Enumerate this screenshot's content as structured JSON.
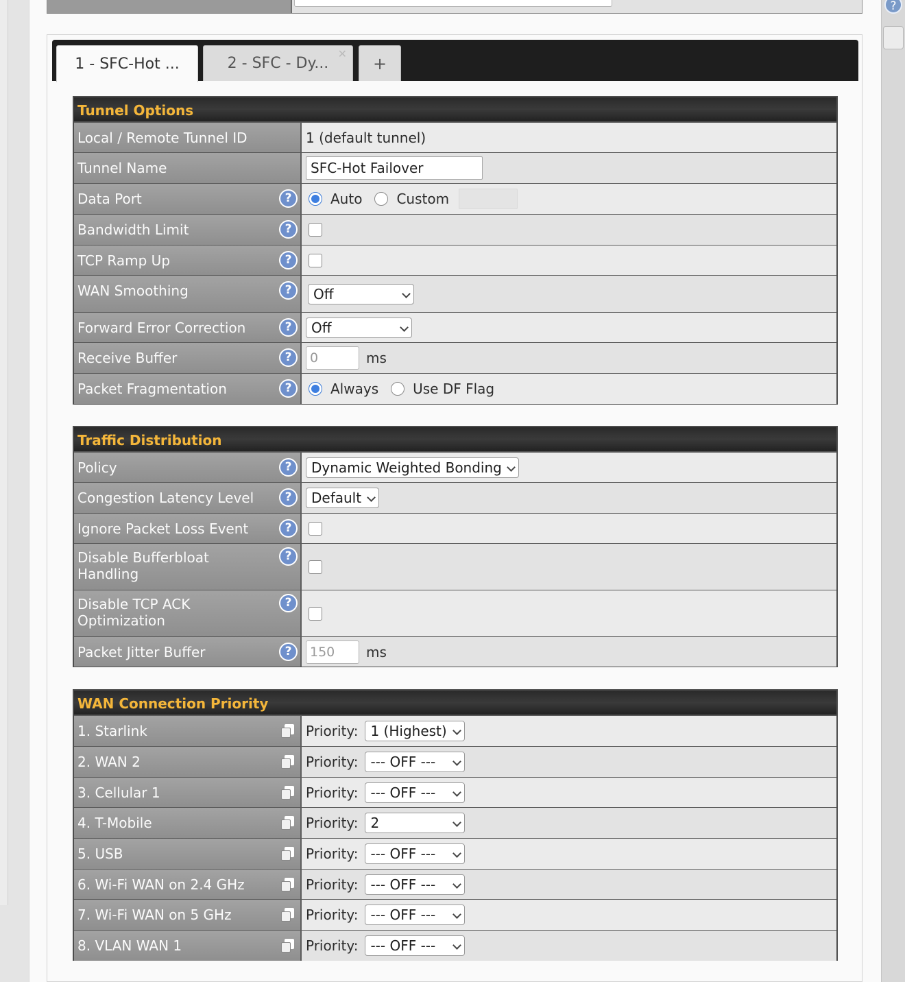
{
  "tabs": [
    {
      "label": "1 - SFC-Hot ..."
    },
    {
      "label": "2 - SFC - Dy..."
    },
    {
      "label": "+"
    }
  ],
  "tunnel_options": {
    "title": "Tunnel Options",
    "local_remote_label": "Local / Remote Tunnel ID",
    "local_remote_value": "1 (default tunnel)",
    "tunnel_name_label": "Tunnel Name",
    "tunnel_name_value": "SFC-Hot Failover",
    "data_port_label": "Data Port",
    "data_port_auto": "Auto",
    "data_port_custom": "Custom",
    "bandwidth_limit_label": "Bandwidth Limit",
    "tcp_ramp_up_label": "TCP Ramp Up",
    "wan_smoothing_label": "WAN Smoothing",
    "wan_smoothing_value": "Off",
    "fec_label": "Forward Error Correction",
    "fec_value": "Off",
    "receive_buffer_label": "Receive Buffer",
    "receive_buffer_value": "0",
    "receive_buffer_unit": "ms",
    "packet_frag_label": "Packet Fragmentation",
    "packet_frag_always": "Always",
    "packet_frag_df": "Use DF Flag"
  },
  "traffic_distribution": {
    "title": "Traffic Distribution",
    "policy_label": "Policy",
    "policy_value": "Dynamic Weighted Bonding",
    "congestion_label": "Congestion Latency Level",
    "congestion_value": "Default",
    "ignore_loss_label": "Ignore Packet Loss Event",
    "bufferbloat_label": "Disable Bufferbloat Handling",
    "tcp_ack_label": "Disable TCP ACK Optimization",
    "jitter_label": "Packet Jitter Buffer",
    "jitter_value": "150",
    "jitter_unit": "ms"
  },
  "wan_priority": {
    "title": "WAN Connection Priority",
    "priority_label": "Priority:",
    "rows": [
      {
        "name": "1. Starlink",
        "value": "1 (Highest)"
      },
      {
        "name": "2. WAN 2",
        "value": "--- OFF ---"
      },
      {
        "name": "3. Cellular 1",
        "value": "--- OFF ---"
      },
      {
        "name": "4. T-Mobile",
        "value": "2"
      },
      {
        "name": "5. USB",
        "value": "--- OFF ---"
      },
      {
        "name": "6. Wi-Fi WAN on 2.4 GHz",
        "value": "--- OFF ---"
      },
      {
        "name": "7. Wi-Fi WAN on 5 GHz",
        "value": "--- OFF ---"
      },
      {
        "name": "8. VLAN WAN 1",
        "value": "--- OFF ---"
      }
    ]
  },
  "colors": {
    "section_title": "#f4b63a",
    "label_cell": "#9a9a9a",
    "help_icon": "#6f90cc",
    "radio_selected": "#3e7fe0"
  }
}
